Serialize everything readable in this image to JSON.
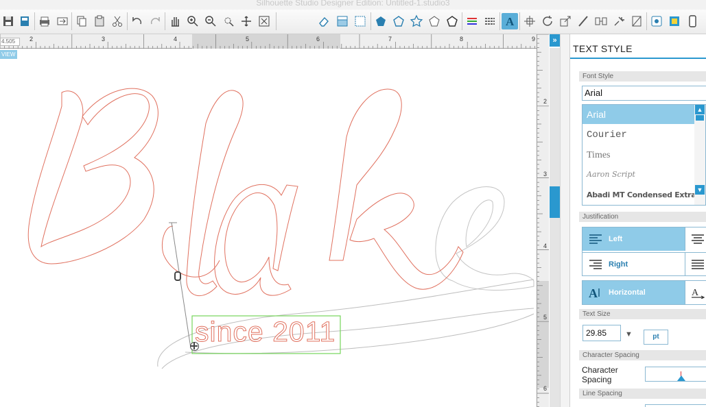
{
  "window": {
    "title": "Silhouette Studio Designer Edition: Untitled-1.studio3"
  },
  "toolbar": {
    "tools": [
      "save-icon",
      "save-to-library-icon",
      "print-icon",
      "send-to-cutter-icon",
      "copy-icon",
      "paste-icon",
      "cut-icon",
      "undo-icon",
      "redo-icon",
      "pan-hand-icon",
      "zoom-in-icon",
      "zoom-out-icon",
      "zoom-select-icon",
      "drag-zoom-icon",
      "fit-to-page-icon",
      "eraser-icon",
      "fill-color-icon",
      "fill-pattern-icon",
      "polygon-icon",
      "trace-icon",
      "star-icon",
      "shape-outline-icon",
      "pentagon-icon",
      "line-color-icon",
      "line-style-icon",
      "text-style-icon",
      "align-icon",
      "rotate-icon",
      "scale-icon",
      "knife-icon",
      "replicate-icon",
      "modify-icon",
      "offset-icon",
      "library-icon",
      "store-icon",
      "phone-icon"
    ],
    "active_tool": "text-style-icon"
  },
  "ruler": {
    "top_labels": [
      "2",
      "3",
      "4",
      "5",
      "6",
      "7",
      "8",
      "9"
    ],
    "right_labels": [
      "2",
      "3",
      "4",
      "5",
      "6"
    ],
    "coordinate_readout": "4.505"
  },
  "canvas": {
    "view_badge": "VIEW",
    "main_text": "Blake",
    "sub_text": "since 2011"
  },
  "panel": {
    "title": "TEXT STYLE",
    "font_style_label": "Font Style",
    "font_input_value": "Arial",
    "fonts": [
      "Arial",
      "Courier",
      "Times",
      "Aaron Script",
      "Abadi MT Condensed Extra"
    ],
    "selected_font": "Arial",
    "justification_label": "Justification",
    "justify_left": "Left",
    "justify_right": "Right",
    "direction_horizontal": "Horizontal",
    "text_size_label": "Text Size",
    "text_size_value": "29.85",
    "text_size_unit": "pt",
    "char_spacing_header": "Character Spacing",
    "char_spacing_label": "Character Spacing",
    "line_spacing_header": "Line Spacing"
  },
  "colors": {
    "accent": "#2a98cf",
    "selection_blue": "#8fcbe8",
    "cut_line_red": "#e0705e",
    "guide_gray": "#bdbdbd",
    "bbox_green": "#76d65a"
  }
}
